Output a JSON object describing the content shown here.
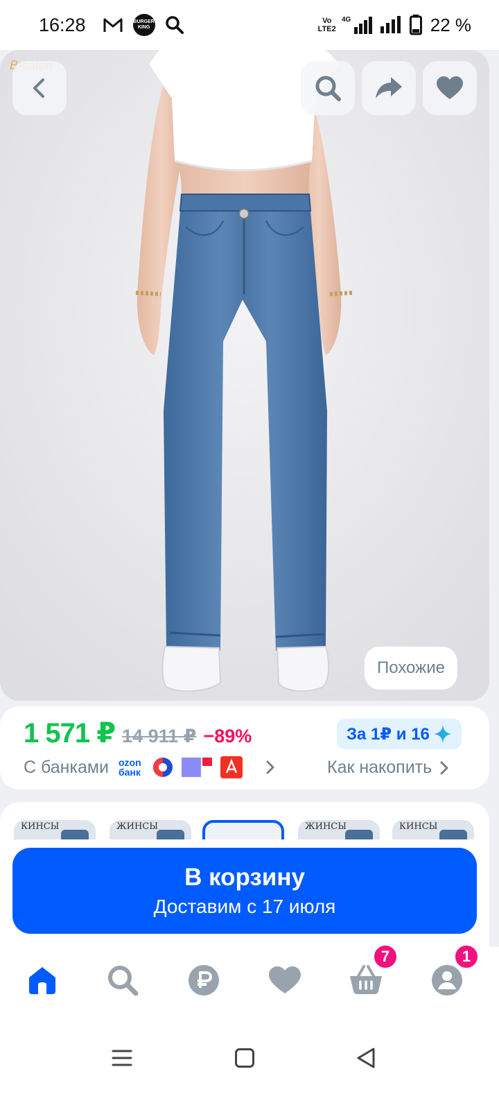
{
  "status_bar": {
    "time": "16:28",
    "left_icons": [
      "gmail-icon",
      "burger-king-icon",
      "search-icon"
    ],
    "burger_king_text": [
      "BURGER",
      "KING"
    ],
    "volte_text": [
      "Vo",
      "LTE2"
    ],
    "network": "4G",
    "battery_percent": "22 %"
  },
  "product_photo": {
    "watermark": "B-caton",
    "similar_label": "Похожие"
  },
  "price": {
    "current": "1 571 ₽",
    "old": "14 911 ₽",
    "discount": "−89%",
    "points_badge": "За 1₽ и 16",
    "banks_label": "С банками",
    "ozon_bank": [
      "ozon",
      "банк"
    ],
    "save_link": "Как накопить"
  },
  "thumbnails": {
    "items": [
      {
        "caption": "КИНСЫ",
        "selected": false
      },
      {
        "caption": "ЖИНСЫ",
        "selected": false
      },
      {
        "caption": "",
        "selected": true
      },
      {
        "caption": "ЖИНСЫ",
        "selected": false
      },
      {
        "caption": "КИНСЫ",
        "selected": false
      }
    ]
  },
  "cart_button": {
    "title": "В корзину",
    "subtitle": "Доставим с 17 июля"
  },
  "tab_bar": {
    "items": [
      {
        "name": "home",
        "icon": "home-icon",
        "active": true
      },
      {
        "name": "catalog-search",
        "icon": "search-icon",
        "active": false
      },
      {
        "name": "finance",
        "icon": "ruble-icon",
        "active": false
      },
      {
        "name": "favorites",
        "icon": "heart-icon",
        "active": false
      },
      {
        "name": "cart",
        "icon": "basket-icon",
        "active": false,
        "badge": "7"
      },
      {
        "name": "profile",
        "icon": "profile-icon",
        "active": false,
        "badge": "1"
      }
    ]
  },
  "colors": {
    "accent_blue": "#005bff",
    "price_green": "#10c44c",
    "discount_red": "#f91155",
    "badge_pink": "#f1117e",
    "muted_grey": "#707f8d"
  }
}
